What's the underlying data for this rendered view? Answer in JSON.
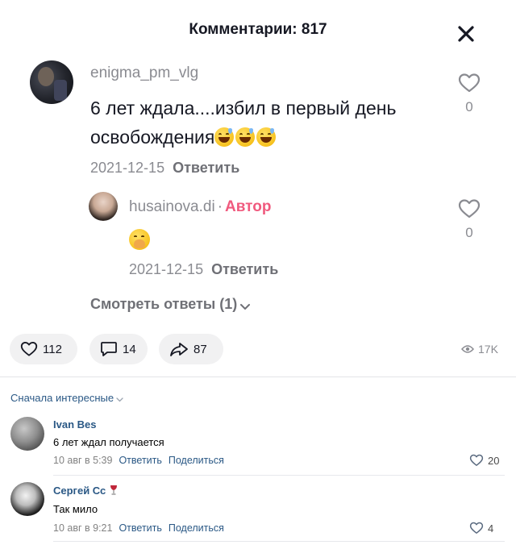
{
  "header": {
    "title": "Комментарии: 817",
    "close_icon": "close-icon"
  },
  "comment": {
    "username": "enigma_pm_vlg",
    "text_line1": "6 лет ждала....избил в первый день",
    "text_line2": "освобождения",
    "emoji": "grinning-sweat-emoji",
    "date": "2021-12-15",
    "reply_label": "Ответить",
    "likes": "0"
  },
  "reply": {
    "username": "husainova.di",
    "separator": "·",
    "author_badge": "Автор",
    "emoji": "hand-over-mouth-emoji",
    "date": "2021-12-15",
    "reply_label": "Ответить",
    "likes": "0"
  },
  "view_replies": "Смотреть ответы (1)",
  "actions": {
    "likes": "112",
    "comments": "14",
    "shares": "87",
    "views": "17K"
  },
  "vk": {
    "sort_label": "Сначала интересные",
    "comments": [
      {
        "name": "Ivan Bes",
        "text": "6 лет ждал получается",
        "date": "10 авг в 5:39",
        "reply": "Ответить",
        "share": "Поделиться",
        "likes": "20"
      },
      {
        "name": "Сергей Сс",
        "badge_icon": "wine-glass-icon",
        "text": "Так мило",
        "date": "10 авг в 9:21",
        "reply": "Ответить",
        "share": "Поделиться",
        "likes": "4"
      }
    ]
  },
  "colors": {
    "author": "#f05a7e",
    "vk_link": "#2a5885",
    "muted": "#8a8b91"
  }
}
